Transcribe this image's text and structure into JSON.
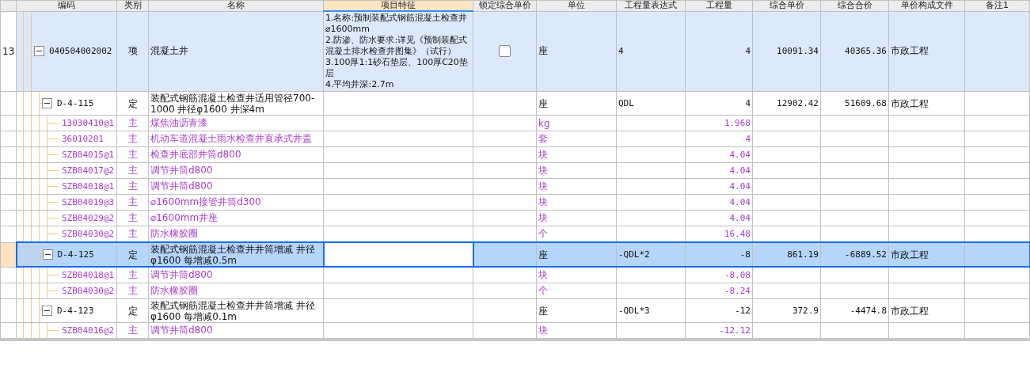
{
  "table": {
    "columns": [
      {
        "label": "编码",
        "selected": false
      },
      {
        "label": "类别",
        "selected": false
      },
      {
        "label": "名称",
        "selected": false
      },
      {
        "label": "项目特征",
        "selected": true
      },
      {
        "label": "锁定综合单价",
        "selected": false
      },
      {
        "label": "单位",
        "selected": false
      },
      {
        "label": "工程量表达式",
        "selected": false
      },
      {
        "label": "工程量",
        "selected": false
      },
      {
        "label": "综合单价",
        "selected": false
      },
      {
        "label": "综合合价",
        "selected": false
      },
      {
        "label": "单价构成文件",
        "selected": false
      },
      {
        "label": "备注1",
        "selected": false
      }
    ],
    "rows": [
      {
        "number": "13",
        "kind": "item",
        "code": "040504002002",
        "type": "项",
        "name": "混凝土井",
        "feature": "1.名称:预制装配式钢筋混凝土检查井⌀1600mm\n2.防渗、防水要求:详见《预制装配式混凝土排水检查井图集》（试行）\n3.100厚1:1砂石垫层、100厚C20垫层\n4.平均井深:2.7m",
        "locked": false,
        "unit": "座",
        "expr": "4",
        "qty": "4",
        "unit_price": "10091.34",
        "total": "40365.36",
        "file": "市政工程",
        "selected": false,
        "expanded": true,
        "children": [
          {
            "kind": "quota",
            "code": "D-4-115",
            "type": "定",
            "name": "装配式钢筋混凝土检查井适用管径700-1000 井径φ1600 井深4m",
            "unit": "座",
            "expr": "QDL",
            "qty": "4",
            "unit_price": "12902.42",
            "total": "51609.68",
            "file": "市政工程",
            "selected": false,
            "expanded": true,
            "children": [
              {
                "kind": "material",
                "code": "13030410@1",
                "type": "主",
                "name": "煤焦油沥青漆",
                "unit": "kg",
                "qty": "1.968",
                "selected": false
              },
              {
                "kind": "material",
                "code": "36010201",
                "type": "主",
                "name": "机动车道混凝土雨水检查井直承式井盖",
                "unit": "套",
                "qty": "4",
                "selected": false
              },
              {
                "kind": "material",
                "code": "SZB04015@1",
                "type": "主",
                "name": "检查井底部井筒d800",
                "unit": "块",
                "qty": "4.04",
                "selected": false
              },
              {
                "kind": "material",
                "code": "SZB04017@2",
                "type": "主",
                "name": "调节井筒d800",
                "unit": "块",
                "qty": "4.04",
                "selected": false
              },
              {
                "kind": "material",
                "code": "SZB04018@1",
                "type": "主",
                "name": "调节井筒d800",
                "unit": "块",
                "qty": "4.04",
                "selected": false
              },
              {
                "kind": "material",
                "code": "SZB04019@3",
                "type": "主",
                "name": "⌀1600mm接管井筒d300",
                "unit": "块",
                "qty": "4.04",
                "selected": false
              },
              {
                "kind": "material",
                "code": "SZB04029@2",
                "type": "主",
                "name": "⌀1600mm井座",
                "unit": "块",
                "qty": "4.04",
                "selected": false
              },
              {
                "kind": "material",
                "code": "SZB04030@2",
                "type": "主",
                "name": "防水橡胶圈",
                "unit": "个",
                "qty": "16.48",
                "selected": false
              }
            ]
          },
          {
            "kind": "quota",
            "code": "D-4-125",
            "type": "定",
            "name": "装配式钢筋混凝土检查井井筒增减 井径φ1600 每增减0.5m",
            "unit": "座",
            "expr": "-QDL*2",
            "qty": "-8",
            "unit_price": "861.19",
            "total": "-6889.52",
            "file": "市政工程",
            "selected": true,
            "expanded": true,
            "children": [
              {
                "kind": "material",
                "code": "SZB04018@1",
                "type": "主",
                "name": "调节井筒d800",
                "unit": "块",
                "qty": "-8.08",
                "selected": false
              },
              {
                "kind": "material",
                "code": "SZB04030@2",
                "type": "主",
                "name": "防水橡胶圈",
                "unit": "个",
                "qty": "-8.24",
                "selected": false
              }
            ]
          },
          {
            "kind": "quota",
            "code": "D-4-123",
            "type": "定",
            "name": "装配式钢筋混凝土检查井井筒增减 井径φ1600 每增减0.1m",
            "unit": "座",
            "expr": "-QDL*3",
            "qty": "-12",
            "unit_price": "372.9",
            "total": "-4474.8",
            "file": "市政工程",
            "selected": false,
            "expanded": true,
            "children": [
              {
                "kind": "material",
                "code": "SZB04016@2",
                "type": "主",
                "name": "调节井筒d800",
                "unit": "块",
                "qty": "-12.12",
                "selected": false
              }
            ]
          }
        ]
      }
    ]
  }
}
